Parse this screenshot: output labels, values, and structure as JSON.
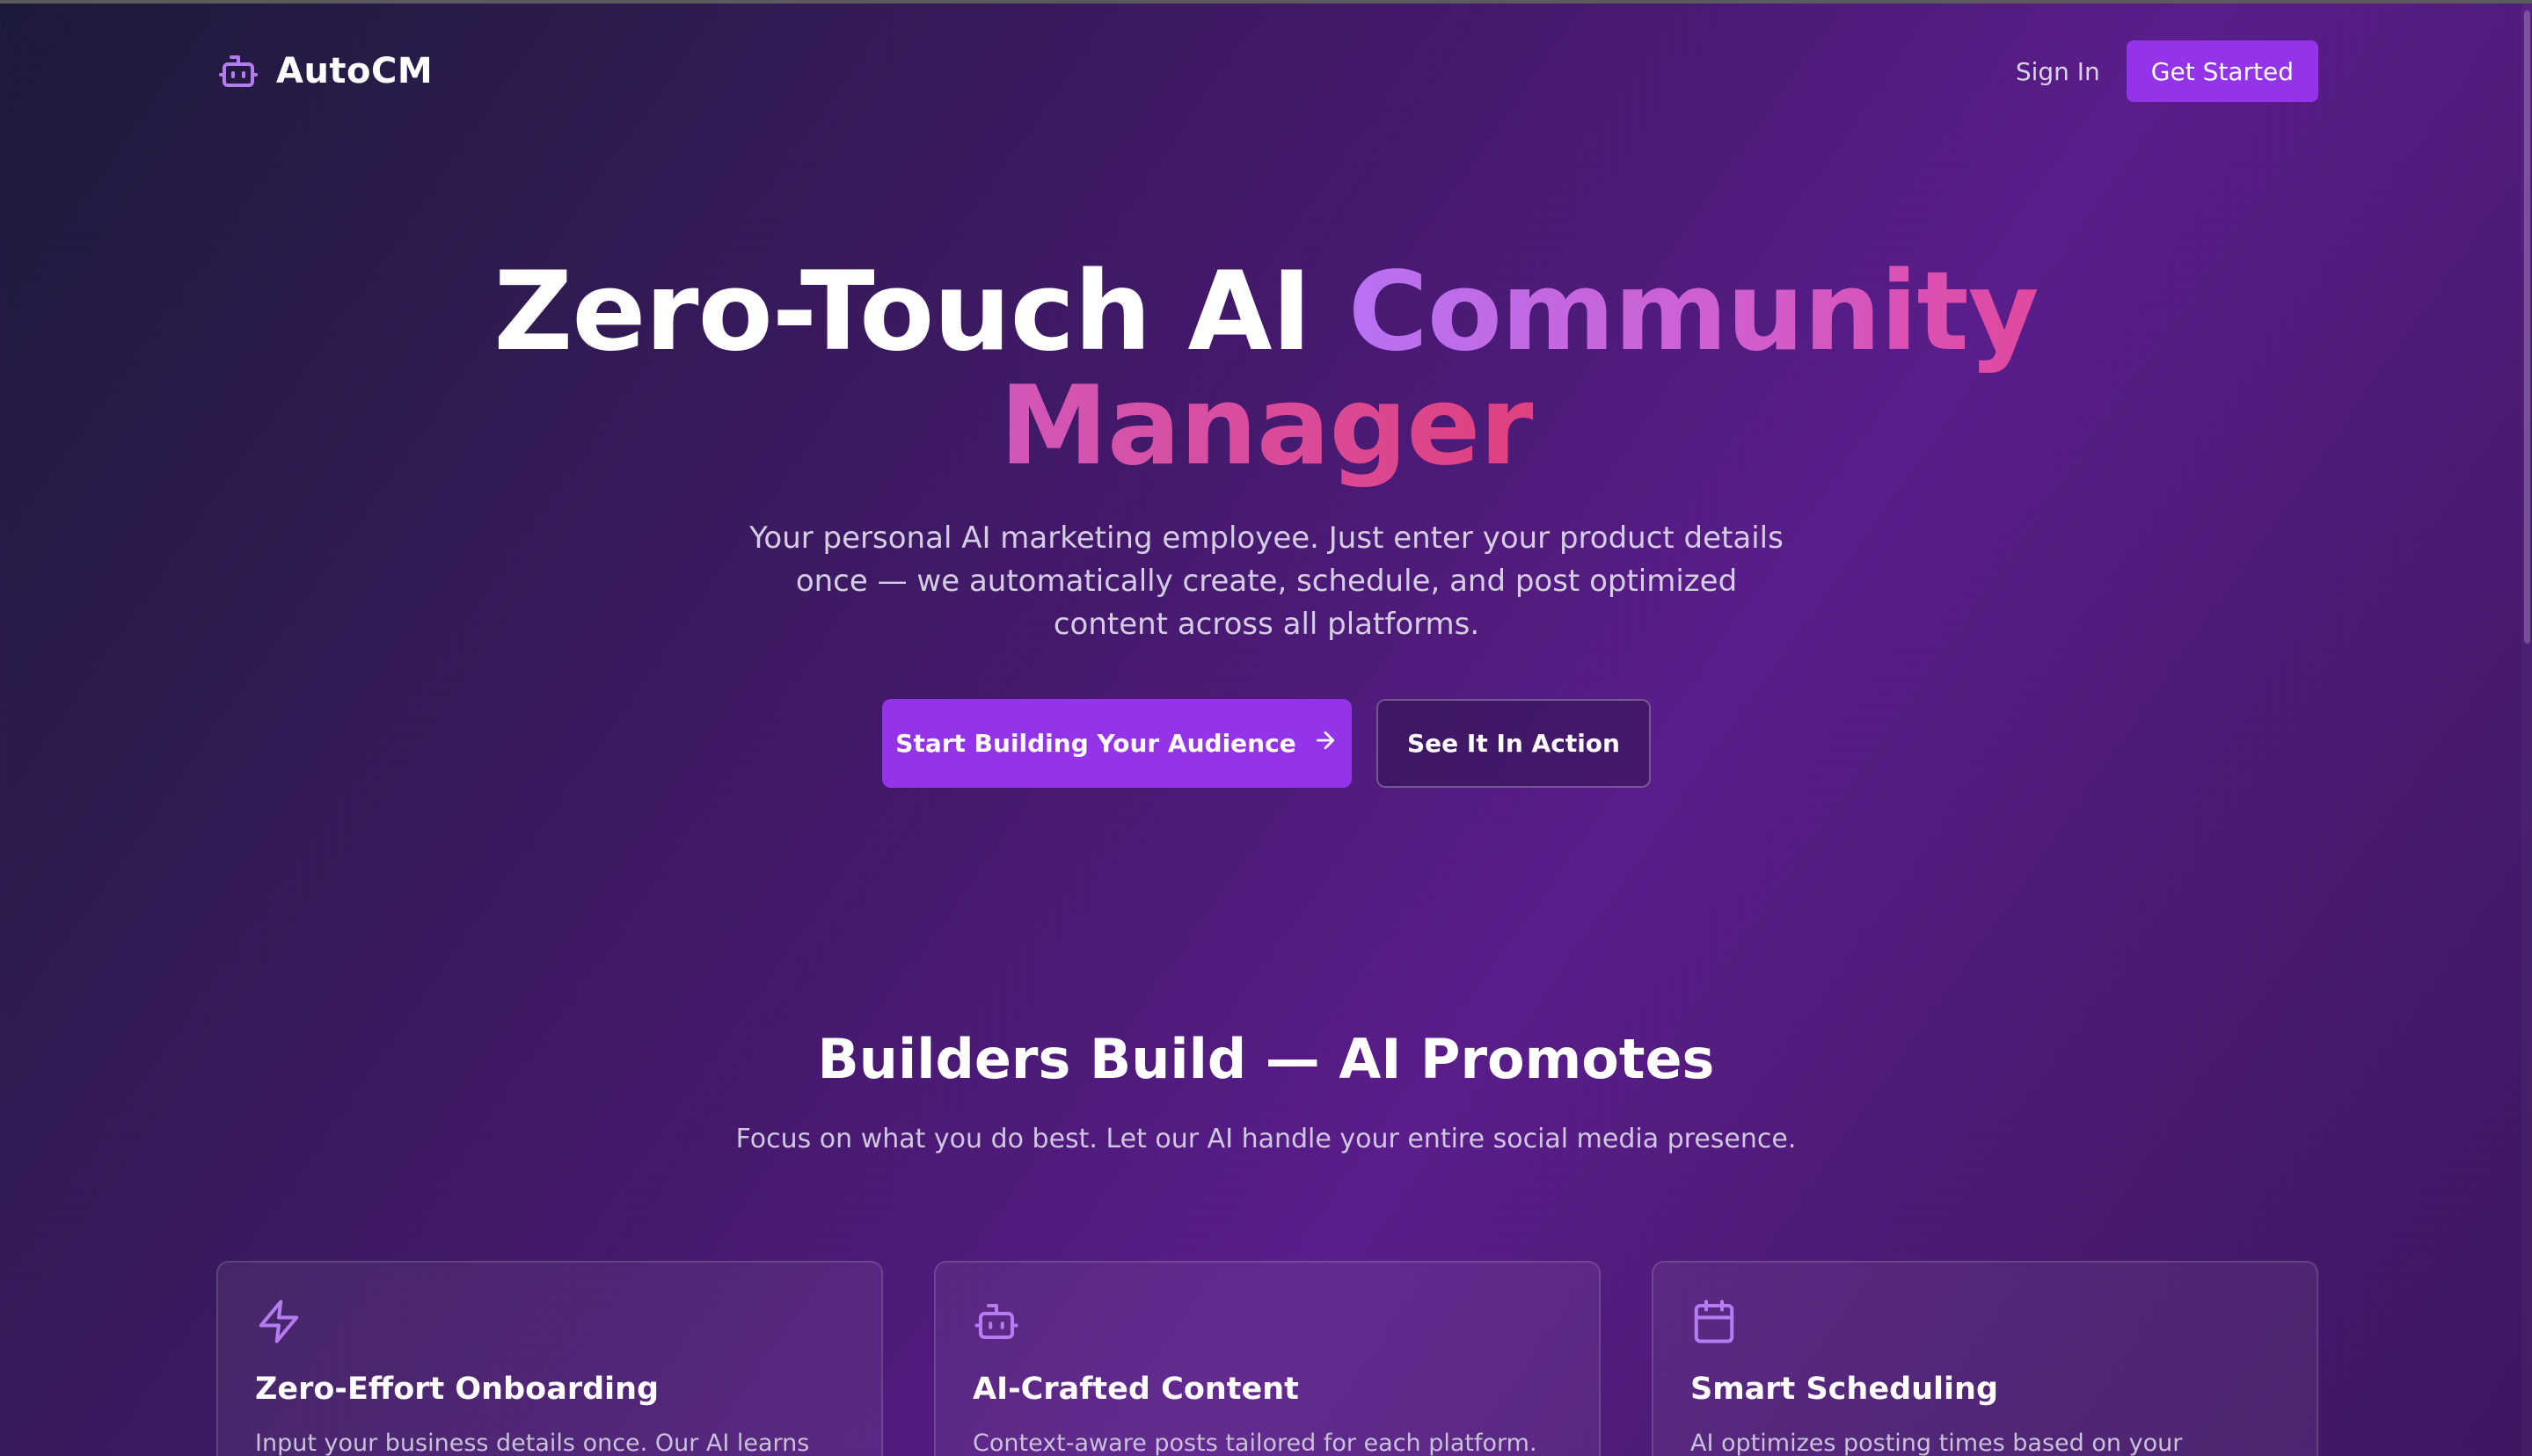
{
  "nav": {
    "brand": "AutoCM",
    "sign_in": "Sign In",
    "get_started": "Get Started"
  },
  "hero": {
    "title_part1": "Zero-Touch AI ",
    "title_part2": "Community",
    "title_part3": "Manager",
    "subtitle": "Your personal AI marketing employee. Just enter your product details once — we automatically create, schedule, and post optimized content across all platforms.",
    "cta_primary": "Start Building Your Audience",
    "cta_secondary": "See It In Action"
  },
  "section": {
    "title": "Builders Build — AI Promotes",
    "subtitle": "Focus on what you do best. Let our AI handle your entire social media presence."
  },
  "cards": [
    {
      "icon": "lightning-icon",
      "title": "Zero-Effort Onboarding",
      "text": "Input your business details once. Our AI learns your"
    },
    {
      "icon": "robot-icon",
      "title": "AI-Crafted Content",
      "text": "Context-aware posts tailored for each platform."
    },
    {
      "icon": "calendar-icon",
      "title": "Smart Scheduling",
      "text": "AI optimizes posting times based on your audience"
    }
  ],
  "colors": {
    "accent": "#9333ea",
    "icon": "#b57bf0",
    "gradient_start": "#b772f3",
    "gradient_end": "#e0409e"
  }
}
